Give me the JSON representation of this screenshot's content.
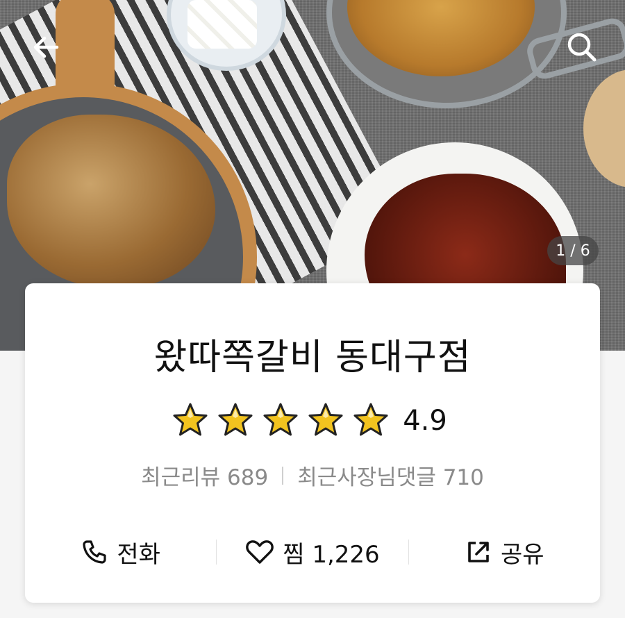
{
  "hero": {
    "photo_counter": "1 / 6",
    "back_icon": "arrow-left-icon",
    "search_icon": "search-icon"
  },
  "store": {
    "name": "왔따쪽갈비 동대구점",
    "rating": "4.9",
    "rating_stars_filled": 5,
    "rating_stars_total": 5,
    "recent_reviews_label": "최근리뷰 689",
    "recent_owner_comments_label": "최근사장님댓글 710"
  },
  "actions": {
    "call_label": "전화",
    "favorite_label": "찜 1,226",
    "share_label": "공유"
  },
  "colors": {
    "star_fill": "#f2c31f",
    "star_outline": "#222222",
    "secondary_text": "#8a8a8a"
  }
}
